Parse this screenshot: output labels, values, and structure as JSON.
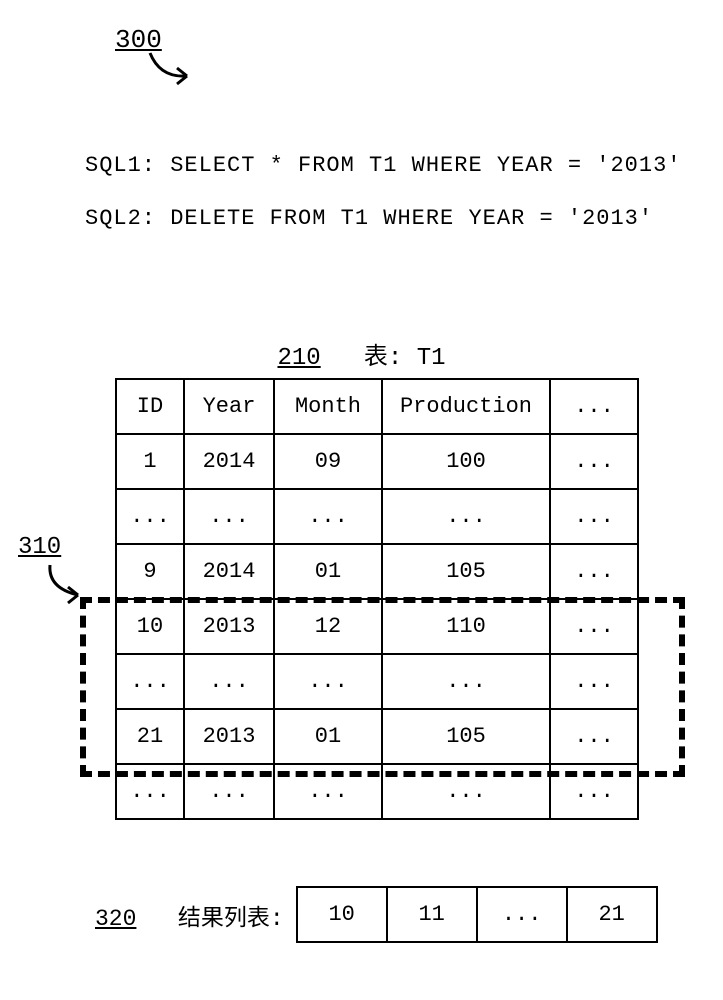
{
  "refs": {
    "r300": "300",
    "r310": "310",
    "r210": "210",
    "r320": "320"
  },
  "sql": {
    "line1": "SQL1: SELECT * FROM T1 WHERE YEAR = '2013'",
    "line2": "SQL2: DELETE FROM T1 WHERE YEAR = '2013'"
  },
  "table": {
    "title_prefix": "表: T1",
    "headers": [
      "ID",
      "Year",
      "Month",
      "Production",
      "..."
    ],
    "rows": [
      [
        "1",
        "2014",
        "09",
        "100",
        "..."
      ],
      [
        "...",
        "...",
        "...",
        "...",
        "..."
      ],
      [
        "9",
        "2014",
        "01",
        "105",
        "..."
      ],
      [
        "10",
        "2013",
        "12",
        "110",
        "..."
      ],
      [
        "...",
        "...",
        "...",
        "...",
        "..."
      ],
      [
        "21",
        "2013",
        "01",
        "105",
        "..."
      ],
      [
        "...",
        "...",
        "...",
        "...",
        "..."
      ]
    ]
  },
  "result": {
    "label": "结果列表:",
    "cells": [
      "10",
      "11",
      "...",
      "21"
    ]
  }
}
